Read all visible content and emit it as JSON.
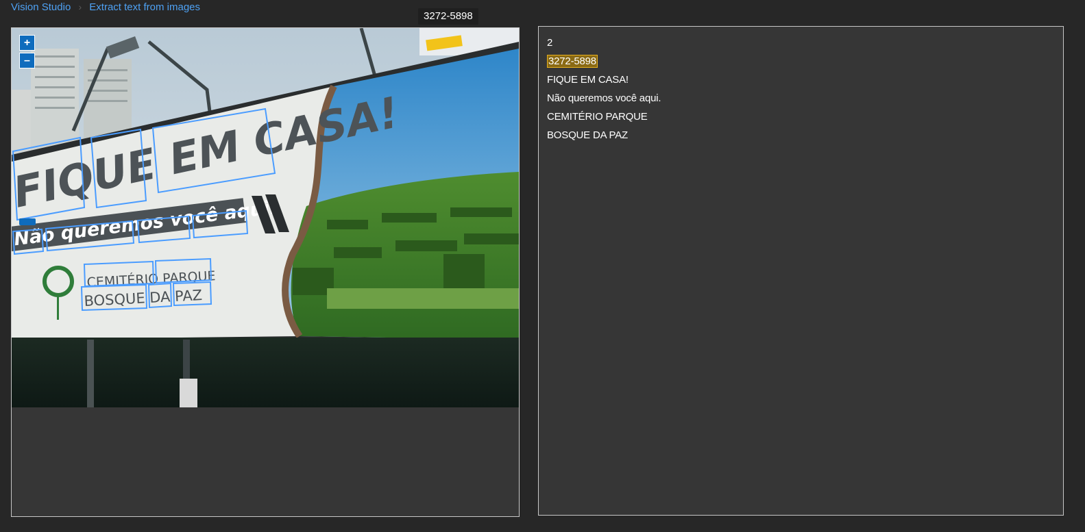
{
  "breadcrumb": {
    "root": "Vision Studio",
    "separator": "›",
    "current": "Extract text from images"
  },
  "tooltip": {
    "text": "3272-5898"
  },
  "viewer": {
    "zoom_in_label": "+",
    "zoom_out_label": "–"
  },
  "billboard": {
    "headline": "FIQUE EM CASA!",
    "subline": "Não queremos você aqui.",
    "brand_line1": "CEMITÉRIO PARQUE",
    "brand_line2": "BOSQUE DA PAZ",
    "phone_tag": "3272-5898"
  },
  "results": {
    "lines": [
      {
        "text": "2",
        "highlighted": false
      },
      {
        "text": "3272-5898",
        "highlighted": true
      },
      {
        "text": "FIQUE EM CASA!",
        "highlighted": false
      },
      {
        "text": "Não queremos você aqui.",
        "highlighted": false
      },
      {
        "text": "CEMITÉRIO PARQUE",
        "highlighted": false
      },
      {
        "text": "BOSQUE DA PAZ",
        "highlighted": false
      }
    ]
  },
  "colors": {
    "background": "#272727",
    "panel": "#363636",
    "link": "#4ea1f3",
    "accent": "#0f6cbd",
    "highlight_border": "#e8b120",
    "bbox": "#4a9cff"
  }
}
